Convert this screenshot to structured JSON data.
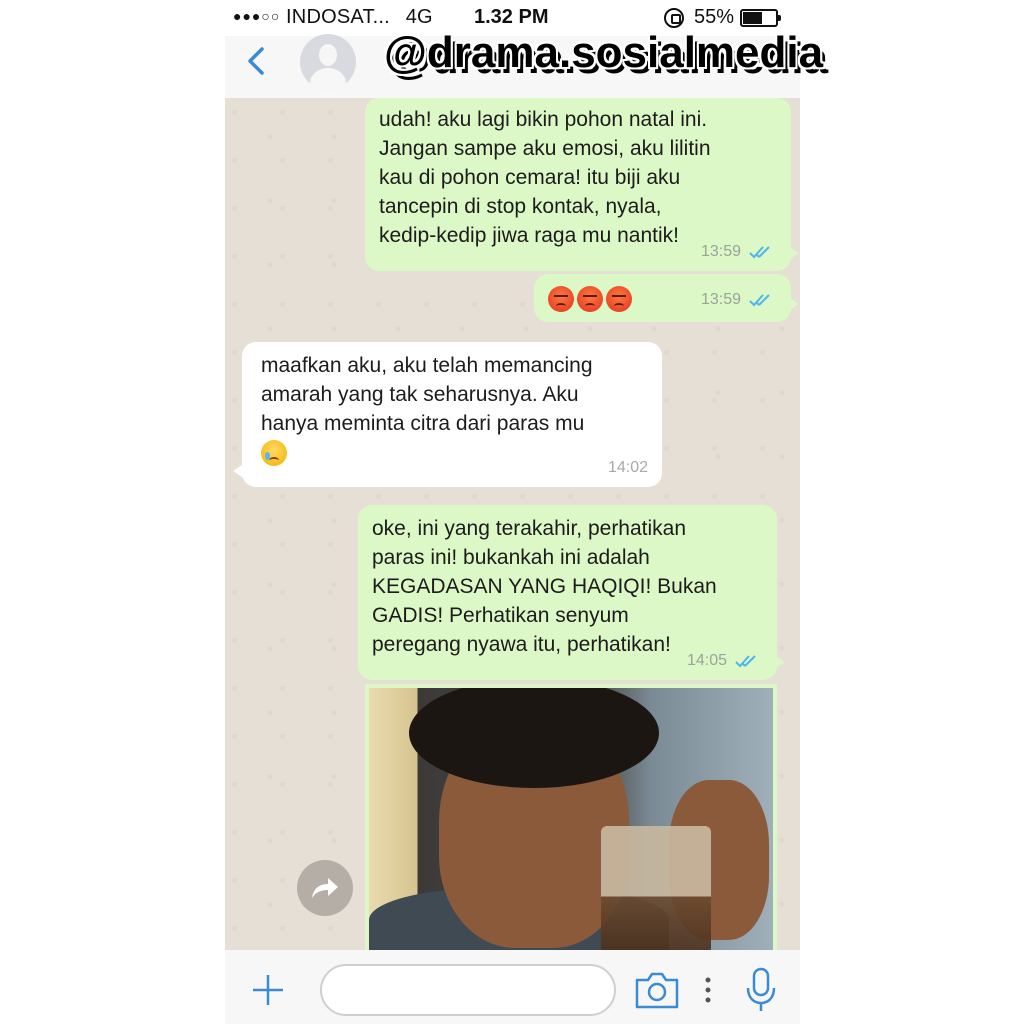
{
  "status_bar": {
    "signal_dots": "●●●○○",
    "carrier": "INDOSAT...",
    "network": "4G",
    "time": "1.32 PM",
    "battery": "55%"
  },
  "header": {
    "back_icon": "chevron-left-icon",
    "watermark": "@drama.sosialmedia"
  },
  "messages": [
    {
      "direction": "out",
      "text": "udah! aku lagi bikin pohon natal ini.\nJangan sampe aku emosi, aku lilitin\nkau di pohon cemara! itu biji aku\ntancepin di stop kontak, nyala,\nkedip-kedip jiwa raga mu nantik!",
      "time": "13:59"
    },
    {
      "direction": "out",
      "emoji": [
        "angry-face",
        "angry-face",
        "angry-face"
      ],
      "time": "13:59"
    },
    {
      "direction": "in",
      "text": "maafkan aku, aku telah memancing\namarah yang tak seharusnya. Aku\nhanya meminta citra dari paras mu",
      "emoji": [
        "crying-face"
      ],
      "time": "14:02"
    },
    {
      "direction": "out",
      "text": "oke, ini yang terakahir, perhatikan\nparas ini! bukankah ini adalah\nKEGADASAN YANG HAQIQI!  Bukan\nGADIS!  Perhatikan senyum\nperegang nyawa itu, perhatikan!",
      "time": "14:05"
    }
  ],
  "input_bar": {
    "placeholder": "",
    "icons": [
      "plus-icon",
      "camera-icon",
      "more-dots-icon",
      "microphone-icon"
    ]
  },
  "colors": {
    "outgoing_bubble": "#dcf8c6",
    "incoming_bubble": "#ffffff",
    "chat_background": "#e6dfd6",
    "tick_blue": "#4fb6ec",
    "accent_blue": "#3a8ad6"
  }
}
